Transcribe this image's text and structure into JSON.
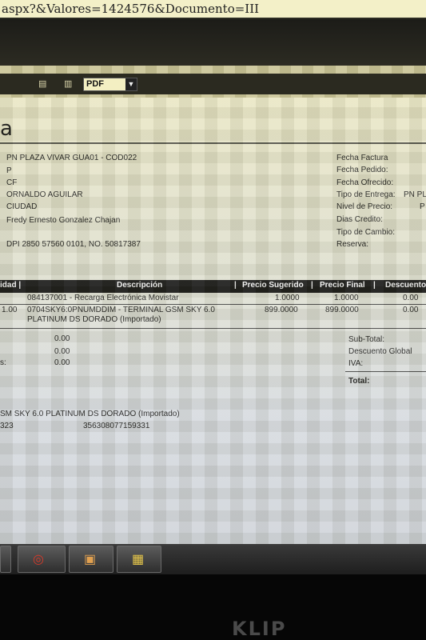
{
  "browser": {
    "address_text": "aspx?&Valores=1424576&Documento=III"
  },
  "toolbar": {
    "format_selected": "PDF",
    "icons": [
      "print-icon",
      "export-icon"
    ]
  },
  "document": {
    "title_partial": "a",
    "customer": {
      "name": "PN PLAZA VIVAR GUA01 - COD022",
      "line2": "P",
      "line3": "CF",
      "contact": "ORNALDO AGUILAR",
      "city": "CIUDAD",
      "seller": "Fredy Ernesto Gonzalez Chajan",
      "dpi": "DPI 2850 57560 0101, NO. 50817387"
    },
    "info_labels": {
      "fecha_factura": "Fecha Factura",
      "fecha_pedido": "Fecha Pedido:",
      "fecha_ofrecido": "Fecha Ofrecido:",
      "tipo_entrega": "Tipo de Entrega:",
      "tipo_entrega_val": "PN PL",
      "nivel_precio": "Nivel de Precio:",
      "nivel_precio_val": "P",
      "dias_credito": "Dias Credito:",
      "tipo_cambio": "Tipo de Cambio:",
      "reserva": "Reserva:"
    },
    "table": {
      "headers": {
        "cantidad": "idad |",
        "descripcion": "Descripción",
        "sep1": "|",
        "precio_sugerido": "Precio Sugerido",
        "sep2": "|",
        "precio_final": "Precio Final",
        "sep3": "|",
        "descuento": "Descuento"
      },
      "rows": [
        {
          "qty": "",
          "desc": "084137001 - Recarga Electrónica  Movistar",
          "desc2": "",
          "sugerido": "1.0000",
          "final": "1.0000",
          "descuento": "0.00"
        },
        {
          "qty": "1.00",
          "desc": "0704SKY6:0PNUMDDIM - TERMINAL GSM SKY 6.0",
          "desc2": "PLATINUM DS DORADO (Importado)",
          "sugerido": "899.0000",
          "final": "899.0000",
          "descuento": "0.00"
        }
      ]
    },
    "totals_left": {
      "v1": "0.00",
      "v2": "0.00",
      "label3": "s:",
      "v3": "0.00"
    },
    "totals_right": {
      "subtotal": "Sub-Total:",
      "descuento_global": "Descuento Global",
      "iva": "IVA:",
      "total": "Total:"
    },
    "serials": {
      "product": "SM SKY 6.0 PLATINUM DS DORADO (Importado)",
      "code": "323",
      "imei": "356308077159331"
    }
  },
  "taskbar": {
    "buttons": [
      "chrome-icon",
      "media-icon",
      "calendar-icon"
    ]
  },
  "monitor": {
    "brand": "KLIP"
  }
}
